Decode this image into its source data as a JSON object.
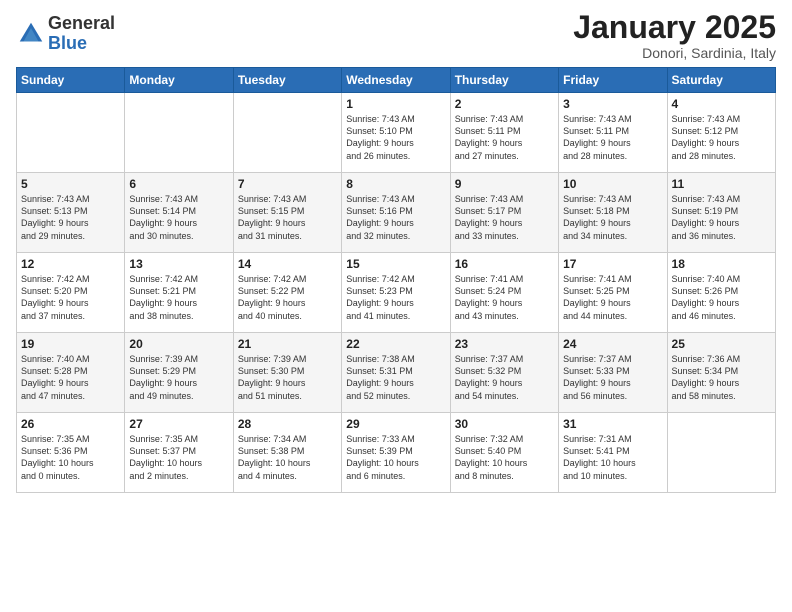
{
  "logo": {
    "general": "General",
    "blue": "Blue"
  },
  "header": {
    "month": "January 2025",
    "location": "Donori, Sardinia, Italy"
  },
  "days_of_week": [
    "Sunday",
    "Monday",
    "Tuesday",
    "Wednesday",
    "Thursday",
    "Friday",
    "Saturday"
  ],
  "weeks": [
    [
      {
        "day": "",
        "content": ""
      },
      {
        "day": "",
        "content": ""
      },
      {
        "day": "",
        "content": ""
      },
      {
        "day": "1",
        "content": "Sunrise: 7:43 AM\nSunset: 5:10 PM\nDaylight: 9 hours\nand 26 minutes."
      },
      {
        "day": "2",
        "content": "Sunrise: 7:43 AM\nSunset: 5:11 PM\nDaylight: 9 hours\nand 27 minutes."
      },
      {
        "day": "3",
        "content": "Sunrise: 7:43 AM\nSunset: 5:11 PM\nDaylight: 9 hours\nand 28 minutes."
      },
      {
        "day": "4",
        "content": "Sunrise: 7:43 AM\nSunset: 5:12 PM\nDaylight: 9 hours\nand 28 minutes."
      }
    ],
    [
      {
        "day": "5",
        "content": "Sunrise: 7:43 AM\nSunset: 5:13 PM\nDaylight: 9 hours\nand 29 minutes."
      },
      {
        "day": "6",
        "content": "Sunrise: 7:43 AM\nSunset: 5:14 PM\nDaylight: 9 hours\nand 30 minutes."
      },
      {
        "day": "7",
        "content": "Sunrise: 7:43 AM\nSunset: 5:15 PM\nDaylight: 9 hours\nand 31 minutes."
      },
      {
        "day": "8",
        "content": "Sunrise: 7:43 AM\nSunset: 5:16 PM\nDaylight: 9 hours\nand 32 minutes."
      },
      {
        "day": "9",
        "content": "Sunrise: 7:43 AM\nSunset: 5:17 PM\nDaylight: 9 hours\nand 33 minutes."
      },
      {
        "day": "10",
        "content": "Sunrise: 7:43 AM\nSunset: 5:18 PM\nDaylight: 9 hours\nand 34 minutes."
      },
      {
        "day": "11",
        "content": "Sunrise: 7:43 AM\nSunset: 5:19 PM\nDaylight: 9 hours\nand 36 minutes."
      }
    ],
    [
      {
        "day": "12",
        "content": "Sunrise: 7:42 AM\nSunset: 5:20 PM\nDaylight: 9 hours\nand 37 minutes."
      },
      {
        "day": "13",
        "content": "Sunrise: 7:42 AM\nSunset: 5:21 PM\nDaylight: 9 hours\nand 38 minutes."
      },
      {
        "day": "14",
        "content": "Sunrise: 7:42 AM\nSunset: 5:22 PM\nDaylight: 9 hours\nand 40 minutes."
      },
      {
        "day": "15",
        "content": "Sunrise: 7:42 AM\nSunset: 5:23 PM\nDaylight: 9 hours\nand 41 minutes."
      },
      {
        "day": "16",
        "content": "Sunrise: 7:41 AM\nSunset: 5:24 PM\nDaylight: 9 hours\nand 43 minutes."
      },
      {
        "day": "17",
        "content": "Sunrise: 7:41 AM\nSunset: 5:25 PM\nDaylight: 9 hours\nand 44 minutes."
      },
      {
        "day": "18",
        "content": "Sunrise: 7:40 AM\nSunset: 5:26 PM\nDaylight: 9 hours\nand 46 minutes."
      }
    ],
    [
      {
        "day": "19",
        "content": "Sunrise: 7:40 AM\nSunset: 5:28 PM\nDaylight: 9 hours\nand 47 minutes."
      },
      {
        "day": "20",
        "content": "Sunrise: 7:39 AM\nSunset: 5:29 PM\nDaylight: 9 hours\nand 49 minutes."
      },
      {
        "day": "21",
        "content": "Sunrise: 7:39 AM\nSunset: 5:30 PM\nDaylight: 9 hours\nand 51 minutes."
      },
      {
        "day": "22",
        "content": "Sunrise: 7:38 AM\nSunset: 5:31 PM\nDaylight: 9 hours\nand 52 minutes."
      },
      {
        "day": "23",
        "content": "Sunrise: 7:37 AM\nSunset: 5:32 PM\nDaylight: 9 hours\nand 54 minutes."
      },
      {
        "day": "24",
        "content": "Sunrise: 7:37 AM\nSunset: 5:33 PM\nDaylight: 9 hours\nand 56 minutes."
      },
      {
        "day": "25",
        "content": "Sunrise: 7:36 AM\nSunset: 5:34 PM\nDaylight: 9 hours\nand 58 minutes."
      }
    ],
    [
      {
        "day": "26",
        "content": "Sunrise: 7:35 AM\nSunset: 5:36 PM\nDaylight: 10 hours\nand 0 minutes."
      },
      {
        "day": "27",
        "content": "Sunrise: 7:35 AM\nSunset: 5:37 PM\nDaylight: 10 hours\nand 2 minutes."
      },
      {
        "day": "28",
        "content": "Sunrise: 7:34 AM\nSunset: 5:38 PM\nDaylight: 10 hours\nand 4 minutes."
      },
      {
        "day": "29",
        "content": "Sunrise: 7:33 AM\nSunset: 5:39 PM\nDaylight: 10 hours\nand 6 minutes."
      },
      {
        "day": "30",
        "content": "Sunrise: 7:32 AM\nSunset: 5:40 PM\nDaylight: 10 hours\nand 8 minutes."
      },
      {
        "day": "31",
        "content": "Sunrise: 7:31 AM\nSunset: 5:41 PM\nDaylight: 10 hours\nand 10 minutes."
      },
      {
        "day": "",
        "content": ""
      }
    ]
  ]
}
